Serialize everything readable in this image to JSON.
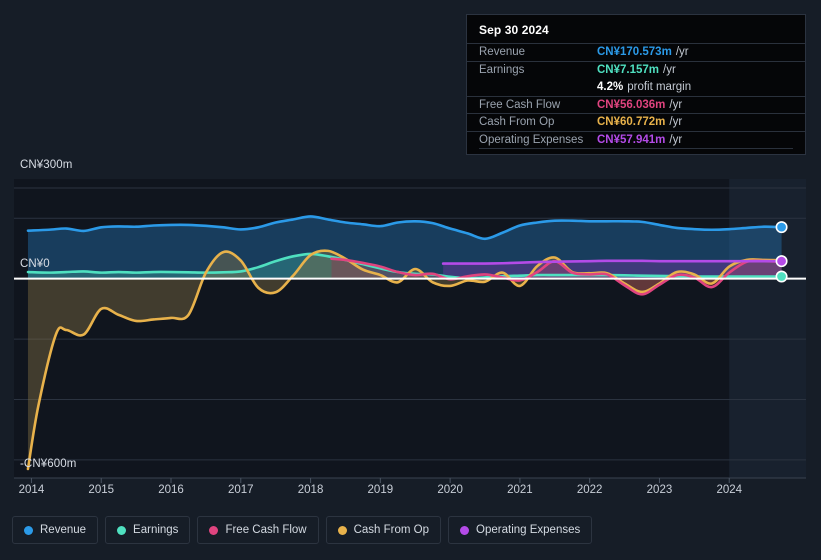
{
  "background": "#161d27",
  "tooltip": {
    "date": "Sep 30 2024",
    "rows": [
      {
        "key": "Revenue",
        "value": "CN¥170.573m",
        "suffix": "/yr",
        "color": "#2b9ae8"
      },
      {
        "key": "Earnings",
        "value": "CN¥7.157m",
        "suffix": "/yr",
        "color": "#4fe0c0"
      },
      {
        "key": "",
        "value": "4.2%",
        "suffix": "profit margin",
        "color": "#ffffff"
      },
      {
        "key": "Free Cash Flow",
        "value": "CN¥56.036m",
        "suffix": "/yr",
        "color": "#e0447f"
      },
      {
        "key": "Cash From Op",
        "value": "CN¥60.772m",
        "suffix": "/yr",
        "color": "#e8b24b"
      },
      {
        "key": "Operating Expenses",
        "value": "CN¥57.941m",
        "suffix": "/yr",
        "color": "#b44be8"
      }
    ]
  },
  "legend": {
    "items": [
      {
        "label": "Revenue",
        "color": "#2b9ae8"
      },
      {
        "label": "Earnings",
        "color": "#4fe0c0"
      },
      {
        "label": "Free Cash Flow",
        "color": "#e0447f"
      },
      {
        "label": "Cash From Op",
        "color": "#e8b24b"
      },
      {
        "label": "Operating Expenses",
        "color": "#b44be8"
      }
    ]
  },
  "chart_data": {
    "type": "line",
    "title": "",
    "xlabel": "",
    "ylabel": "",
    "currency": "CN¥",
    "units": "millions",
    "grid": true,
    "legend_position": "bottom",
    "y_axis": {
      "labels": [
        "CN¥300m",
        "CN¥0",
        "-CN¥600m"
      ],
      "values": [
        300,
        0,
        -600
      ],
      "ylim": [
        -660,
        330
      ],
      "gridline_values": [
        300,
        200,
        0,
        -200,
        -400,
        -600
      ]
    },
    "x_axis": {
      "tick_labels": [
        "2014",
        "2015",
        "2016",
        "2017",
        "2018",
        "2019",
        "2020",
        "2021",
        "2022",
        "2023",
        "2024"
      ],
      "tick_values": [
        2014,
        2015,
        2016,
        2017,
        2018,
        2019,
        2020,
        2021,
        2022,
        2023,
        2024
      ],
      "xlim": [
        2013.75,
        2025.1
      ],
      "forecast_start": 2024.0
    },
    "series": [
      {
        "name": "Revenue",
        "color": "#2b9ae8",
        "fill": "rgba(35,110,170,0.45)",
        "x": [
          2013.95,
          2014.25,
          2014.5,
          2014.75,
          2015.0,
          2015.25,
          2015.5,
          2015.75,
          2016.0,
          2016.25,
          2016.5,
          2016.75,
          2017.0,
          2017.25,
          2017.5,
          2017.75,
          2018.0,
          2018.25,
          2018.5,
          2018.75,
          2019.0,
          2019.25,
          2019.5,
          2019.75,
          2020.0,
          2020.25,
          2020.5,
          2020.75,
          2021.0,
          2021.25,
          2021.5,
          2021.75,
          2022.0,
          2022.25,
          2022.5,
          2022.75,
          2023.0,
          2023.25,
          2023.5,
          2023.75,
          2024.0,
          2024.25,
          2024.5,
          2024.75
        ],
        "y": [
          159,
          162,
          166,
          158,
          170,
          173,
          172,
          176,
          178,
          178,
          175,
          170,
          163,
          170,
          186,
          196,
          206,
          196,
          186,
          180,
          174,
          186,
          190,
          184,
          166,
          150,
          132,
          152,
          176,
          186,
          192,
          192,
          190,
          190,
          190,
          188,
          178,
          168,
          164,
          162,
          164,
          168,
          172,
          170.6
        ]
      },
      {
        "name": "Earnings",
        "color": "#4fe0c0",
        "fill": "rgba(60,160,150,0.42)",
        "x": [
          2013.95,
          2014.25,
          2014.5,
          2014.75,
          2015.0,
          2015.25,
          2015.5,
          2015.75,
          2016.0,
          2016.25,
          2016.5,
          2016.75,
          2017.0,
          2017.25,
          2017.5,
          2017.75,
          2018.0,
          2018.25,
          2018.5,
          2018.75,
          2019.0,
          2019.25,
          2019.5,
          2019.75,
          2020.0,
          2020.25,
          2020.5,
          2020.75,
          2021.0,
          2021.25,
          2021.5,
          2021.75,
          2022.0,
          2022.25,
          2022.5,
          2022.75,
          2023.0,
          2023.25,
          2023.5,
          2023.75,
          2024.0,
          2024.25,
          2024.5,
          2024.75
        ],
        "y": [
          22,
          20,
          22,
          24,
          20,
          22,
          20,
          22,
          22,
          21,
          20,
          21,
          24,
          38,
          58,
          74,
          82,
          74,
          62,
          48,
          34,
          22,
          16,
          14,
          6,
          2,
          4,
          8,
          10,
          12,
          12,
          12,
          12,
          12,
          11,
          10,
          9,
          8,
          7,
          7,
          7,
          7,
          7,
          7.2
        ]
      },
      {
        "name": "Free Cash Flow",
        "color": "#e0447f",
        "fill": "rgba(150,50,80,0.38)",
        "x": [
          2018.3,
          2018.5,
          2018.75,
          2019.0,
          2019.25,
          2019.5,
          2019.75,
          2020.0,
          2020.25,
          2020.5,
          2020.75,
          2021.0,
          2021.25,
          2021.5,
          2021.75,
          2022.0,
          2022.25,
          2022.5,
          2022.75,
          2023.0,
          2023.25,
          2023.5,
          2023.75,
          2024.0,
          2024.25,
          2024.5,
          2024.75
        ],
        "y": [
          66,
          62,
          52,
          40,
          22,
          12,
          16,
          -2,
          8,
          14,
          4,
          -6,
          22,
          58,
          20,
          14,
          14,
          -22,
          -52,
          -20,
          12,
          4,
          -28,
          20,
          56,
          58,
          56.0
        ]
      },
      {
        "name": "Cash From Op",
        "color": "#e8b24b",
        "fill": "rgba(140,120,70,0.40)",
        "x": [
          2013.95,
          2014.1,
          2014.35,
          2014.5,
          2014.75,
          2015.0,
          2015.25,
          2015.5,
          2015.75,
          2016.0,
          2016.25,
          2016.5,
          2016.75,
          2017.0,
          2017.25,
          2017.5,
          2017.75,
          2018.0,
          2018.25,
          2018.5,
          2018.75,
          2019.0,
          2019.25,
          2019.5,
          2019.75,
          2020.0,
          2020.25,
          2020.5,
          2020.75,
          2021.0,
          2021.25,
          2021.5,
          2021.75,
          2022.0,
          2022.25,
          2022.5,
          2022.75,
          2023.0,
          2023.25,
          2023.5,
          2023.75,
          2024.0,
          2024.25,
          2024.5,
          2024.75
        ],
        "y": [
          -630,
          -420,
          -185,
          -170,
          -185,
          -100,
          -120,
          -140,
          -135,
          -130,
          -120,
          20,
          88,
          60,
          -30,
          -45,
          10,
          78,
          92,
          66,
          30,
          12,
          -12,
          32,
          -12,
          -24,
          -6,
          -10,
          20,
          -24,
          42,
          70,
          22,
          18,
          18,
          -16,
          -44,
          -16,
          22,
          14,
          -16,
          40,
          62,
          62,
          60.8
        ]
      },
      {
        "name": "Operating Expenses",
        "color": "#b44be8",
        "fill": "rgba(110,55,160,0.45)",
        "x": [
          2019.9,
          2020.25,
          2020.5,
          2020.75,
          2021.0,
          2021.25,
          2021.5,
          2021.75,
          2022.0,
          2022.25,
          2022.5,
          2022.75,
          2023.0,
          2023.25,
          2023.5,
          2023.75,
          2024.0,
          2024.25,
          2024.5,
          2024.75
        ],
        "y": [
          50,
          50,
          50,
          51,
          53,
          55,
          56,
          57,
          58,
          59,
          59,
          59,
          58,
          58,
          58,
          58,
          58,
          58,
          58,
          57.9
        ]
      }
    ]
  }
}
